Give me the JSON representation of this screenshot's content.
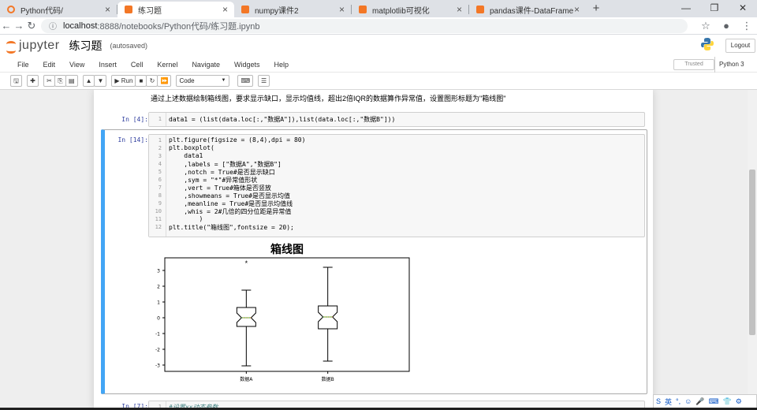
{
  "browser": {
    "tabs": [
      {
        "title": "Python代码/",
        "active": false
      },
      {
        "title": "练习题",
        "active": true
      },
      {
        "title": "numpy课件2",
        "active": false
      },
      {
        "title": "matplotlib可视化",
        "active": false
      },
      {
        "title": "pandas课件-DataFrame",
        "active": false
      }
    ],
    "new_tab": "+",
    "url_host": "localhost",
    "url_path": ":8888/notebooks/Python代码/练习题.ipynb"
  },
  "jupyter": {
    "logo_text": "jupyter",
    "notebook_name": "练习题",
    "autosave": "(autosaved)",
    "logout": "Logout",
    "trusted": "Trusted",
    "kernel": "Python 3"
  },
  "menu": [
    "File",
    "Edit",
    "View",
    "Insert",
    "Cell",
    "Kernel",
    "Navigate",
    "Widgets",
    "Help"
  ],
  "toolbar": {
    "run_label": "Run",
    "cell_type": "Code"
  },
  "notebook": {
    "markdown_text": "通过上述数据绘制箱线图，要求显示缺口，显示均值线，超出2倍IQR的数据算作异常值，设置图形标题为\"箱线图\"",
    "cells": [
      {
        "prompt": "In  [4]:",
        "lines": [
          "data1 = (list(data.loc[:,\"数据A\"]),list(data.loc[:,\"数据B\"]))"
        ]
      },
      {
        "prompt": "In  [14]:",
        "lines": [
          "plt.figure(figsize = (8,4),dpi = 80)",
          "plt.boxplot(",
          "    data1",
          "    ,labels = [\"数据A\",\"数据B\"]",
          "    ,notch = True#是否显示缺口",
          "    ,sym = \"*\"#异常值形状",
          "    ,vert = True#箱体是否竖放",
          "    ,showmeans = True#是否显示均值",
          "    ,meanline = True#是否显示均值线",
          "    ,whis = 2#几倍的四分位距是异常值",
          "        )",
          "plt.title(\"箱线图\",fontsize = 20);"
        ]
      },
      {
        "prompt": "In  [7]:",
        "lines": [
          "#设置xx动态参数"
        ]
      }
    ]
  },
  "chart_data": {
    "type": "box",
    "title": "箱线图",
    "categories": [
      "数据A",
      "数据B"
    ],
    "ylim": [
      -3.4,
      3.8
    ],
    "yticks": [
      -3,
      -2,
      -1,
      0,
      1,
      2,
      3
    ],
    "boxes": [
      {
        "name": "数据A",
        "whisker_low": -3.05,
        "q1": -0.55,
        "median": 0.0,
        "q3": 0.65,
        "whisker_high": 1.75,
        "notch_low": -0.3,
        "notch_high": 0.3,
        "mean": 0.0,
        "outliers": [
          3.45
        ]
      },
      {
        "name": "数据B",
        "whisker_low": -2.75,
        "q1": -0.7,
        "median": 0.05,
        "q3": 0.75,
        "whisker_high": 3.2,
        "notch_low": -0.25,
        "notch_high": 0.35,
        "mean": 0.05,
        "outliers": []
      }
    ],
    "colors": {
      "box": "#000000",
      "median": "#ff7f0e",
      "mean": "#2ca02c"
    }
  }
}
